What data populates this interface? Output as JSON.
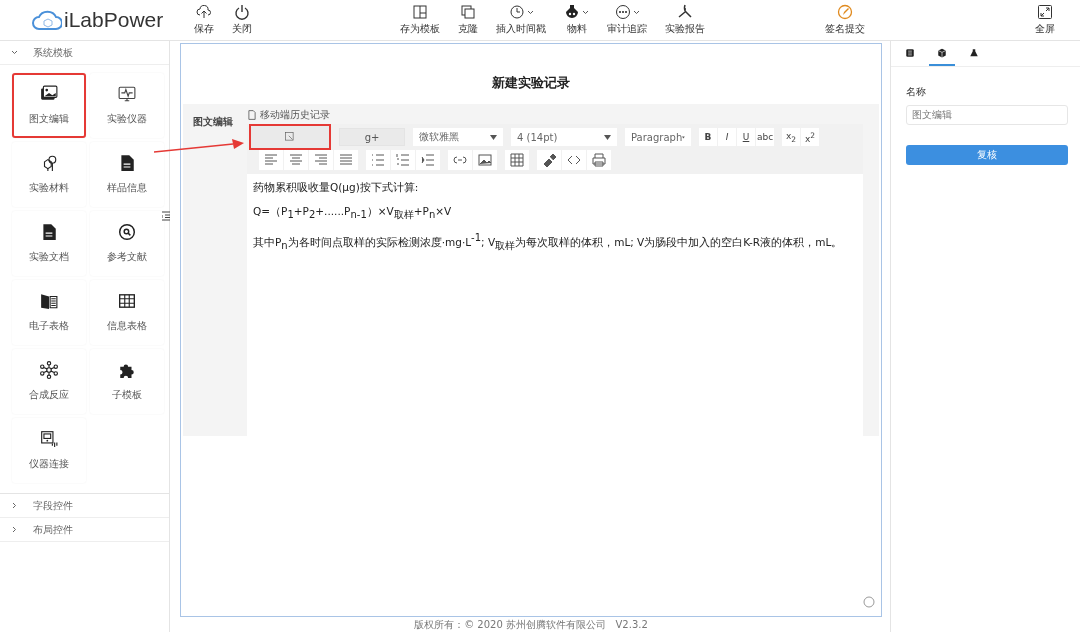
{
  "toolbar": {
    "logo": "iLabPower",
    "left_buttons": [
      {
        "label": "保存",
        "dropdown": false
      },
      {
        "label": "关闭",
        "dropdown": false
      }
    ],
    "center_buttons": [
      {
        "label": "存为模板",
        "dropdown": false
      },
      {
        "label": "克隆",
        "dropdown": false
      },
      {
        "label": "插入时间戳",
        "dropdown": true
      },
      {
        "label": "物料",
        "dropdown": true
      },
      {
        "label": "审计追踪",
        "dropdown": true
      },
      {
        "label": "实验报告",
        "dropdown": false
      }
    ],
    "sign_button": {
      "label": "签名提交"
    },
    "fullscreen_button": {
      "label": "全屏"
    }
  },
  "sidebar": {
    "sections": [
      {
        "title": "系统模板",
        "expanded": true,
        "items": [
          {
            "label": "图文编辑",
            "highlighted": true
          },
          {
            "label": "实验仪器",
            "highlighted": false
          },
          {
            "label": "实验材料",
            "highlighted": false
          },
          {
            "label": "样品信息",
            "highlighted": false
          },
          {
            "label": "实验文档",
            "highlighted": false
          },
          {
            "label": "参考文献",
            "highlighted": false
          },
          {
            "label": "电子表格",
            "highlighted": false
          },
          {
            "label": "信息表格",
            "highlighted": false
          },
          {
            "label": "合成反应",
            "highlighted": false
          },
          {
            "label": "子模板",
            "highlighted": false
          },
          {
            "label": "仪器连接",
            "highlighted": false
          }
        ]
      },
      {
        "title": "字段控件",
        "expanded": false
      },
      {
        "title": "布局控件",
        "expanded": false
      }
    ]
  },
  "canvas": {
    "title": "新建实验记录",
    "block_label": "图文编辑",
    "history_link": "移动端历史记录",
    "editor": {
      "row1": [
        {
          "kind": "icon_button",
          "highlighted": true
        },
        {
          "kind": "button",
          "label": "g+",
          "highlighted": false
        },
        {
          "kind": "select",
          "label": "微软雅黑"
        },
        {
          "kind": "select",
          "label": "4 (14pt)"
        },
        {
          "kind": "select",
          "label": "Paragraph"
        },
        {
          "kind": "format",
          "labels": [
            "B",
            "I",
            "U",
            "abc"
          ]
        },
        {
          "kind": "format",
          "labels": [
            "x$_{2}$",
            "x$^{2}$"
          ]
        }
      ],
      "paragraphs": [
        "药物累积吸收量Q(μg)按下式计算:",
        "Q=（P$_{1}$+P$_{2}$+......P$_{n-1}$）×V$_{取样}$+P$_{n}$×V",
        "其中P$_{n}$为各时间点取样的实际检测浓度·mg·L$^{-1}$; V$_{取样}$为每次取样的体积，mL; V为肠段中加入的空白K-R液的体积，mL。"
      ]
    }
  },
  "footer": "版权所有：© 2020 苏州创腾软件有限公司   V2.3.2",
  "right_panel": {
    "tabs": [
      {
        "selected": false
      },
      {
        "selected": true
      },
      {
        "selected": false
      }
    ],
    "name_label": "名称",
    "name_value": "图文编辑",
    "review_button": "复核"
  }
}
